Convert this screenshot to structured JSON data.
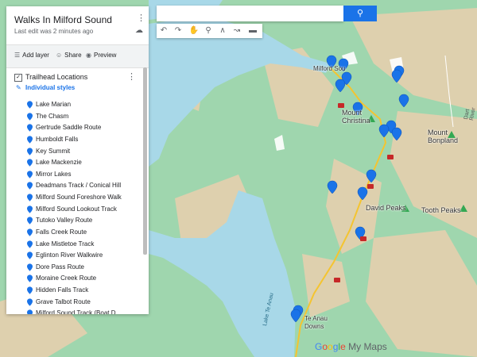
{
  "panel": {
    "title": "Walks In Milford Sound",
    "last_edit": "Last edit was 2 minutes ago",
    "actions": {
      "add_layer": "Add layer",
      "share": "Share",
      "preview": "Preview"
    },
    "layer": {
      "title": "Trailhead Locations",
      "styles_label": "Individual styles",
      "checked": true,
      "items": [
        "Lake Marian",
        "The Chasm",
        "Gertrude Saddle Route",
        "Humboldt Falls",
        "Key Summit",
        "Lake Mackenzie",
        "Mirror Lakes",
        "Deadmans Track / Conical Hill",
        "Milford Sound Foreshore Walk",
        "Milford Sound Lookout Track",
        "Tutoko Valley Route",
        "Falls Creek Route",
        "Lake Mistletoe Track",
        "Eglinton River Walkwire",
        "Dore Pass Route",
        "Moraine Creek Route",
        "Hidden Falls Track",
        "Grave Talbot Route",
        "Milford Sound Track (Boat D..."
      ]
    }
  },
  "map": {
    "labels": {
      "milford": "Milford Sou",
      "christina": "Mount\nChristina",
      "bonpland": "Mount\nBonpland",
      "david_peaks": "David Peaks",
      "tooth_peaks": "Tooth Peaks",
      "te_anau_downs": "Te Anau\nDowns",
      "lake_te_anau": "Lake Te Anau",
      "dart": "Dart River"
    },
    "road_shields": [
      "94",
      "94",
      "94",
      "94",
      "94"
    ],
    "brand": "Google My Maps",
    "colors": {
      "water": "#a7d8e6",
      "land": "#9dd5b0",
      "mountain": "#e6c9a8",
      "pin": "#1a73e8",
      "road": "#f4c430"
    }
  }
}
